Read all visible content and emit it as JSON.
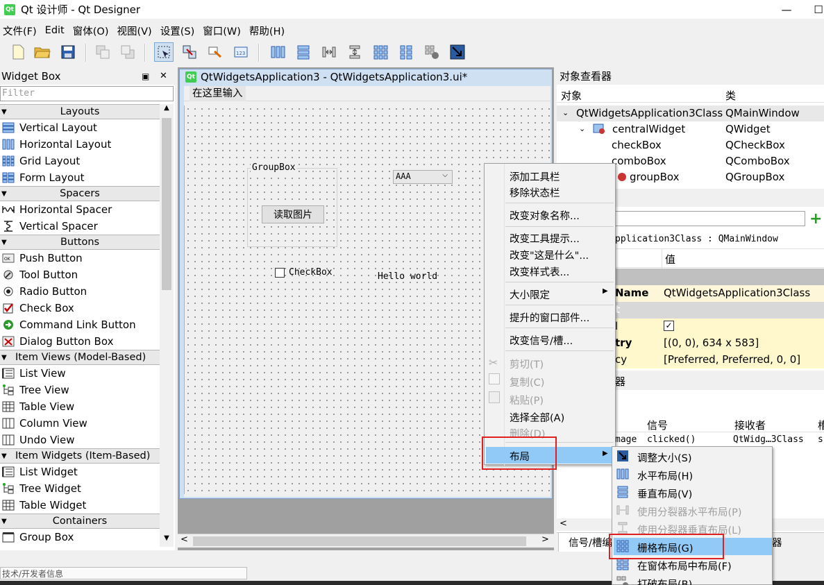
{
  "window": {
    "title": "Qt 设计师 - Qt Designer",
    "logo": "Qt",
    "min": "—",
    "max": "☐"
  },
  "menubar": [
    "文件(F)",
    "Edit",
    "窗体(O)",
    "视图(V)",
    "设置(S)",
    "窗口(W)",
    "帮助(H)"
  ],
  "toolbar": {
    "icons": [
      "new-file-icon",
      "open-folder-icon",
      "save-icon",
      "send-back-icon",
      "bring-front-icon",
      "edit-widgets-icon",
      "edit-signals-icon",
      "edit-buddies-icon",
      "edit-tab-order-icon",
      "layout-horizontal-icon",
      "layout-vertical-icon",
      "layout-h-splitter-icon",
      "layout-v-splitter-icon",
      "layout-grid-icon",
      "layout-form-icon",
      "break-layout-icon",
      "adjust-size-icon"
    ]
  },
  "widgetbox": {
    "title": "Widget Box",
    "filter_placeholder": "Filter",
    "float": "▣",
    "close": "✕",
    "categories": [
      {
        "label": "Layouts",
        "items": [
          "Vertical Layout",
          "Horizontal Layout",
          "Grid Layout",
          "Form Layout"
        ]
      },
      {
        "label": "Spacers",
        "items": [
          "Horizontal Spacer",
          "Vertical Spacer"
        ]
      },
      {
        "label": "Buttons",
        "items": [
          "Push Button",
          "Tool Button",
          "Radio Button",
          "Check Box",
          "Command Link Button",
          "Dialog Button Box"
        ]
      },
      {
        "label": "Item Views (Model-Based)",
        "items": [
          "List View",
          "Tree View",
          "Table View",
          "Column View",
          "Undo View"
        ]
      },
      {
        "label": "Item Widgets (Item-Based)",
        "items": [
          "List Widget",
          "Tree Widget",
          "Table Widget"
        ]
      },
      {
        "label": "Containers",
        "items": [
          "Group Box"
        ]
      }
    ]
  },
  "form": {
    "title": "QtWidgetsApplication3 - QtWidgetsApplication3.ui*",
    "logo": "Qt",
    "menu_placeholder": "在这里输入",
    "groupbox_title": "GroupBox",
    "button_label": "读取图片",
    "combo_value": "AAA",
    "checkbox_label": "CheckBox",
    "label_text": "Hello world"
  },
  "object_inspector": {
    "title": "对象查看器",
    "col_object": "对象",
    "col_class": "类",
    "rows": [
      {
        "name": "QtWidgetsApplication3Class",
        "cls": "QMainWindow"
      },
      {
        "name": "centralWidget",
        "cls": "QWidget"
      },
      {
        "name": "checkBox",
        "cls": "QCheckBox"
      },
      {
        "name": "comboBox",
        "cls": "QComboBox"
      },
      {
        "name": "groupBox",
        "cls": "QGroupBox"
      }
    ]
  },
  "property_editor": {
    "object_line": "pplication3Class : QMainWindow",
    "col_value": "值",
    "rows": [
      {
        "name": "Name",
        "value": "QtWidgetsApplication3Class"
      },
      {
        "name": "t",
        "value": ""
      },
      {
        "name": "l",
        "value": "✓"
      },
      {
        "name": "try",
        "value": "[(0, 0), 634 x 583]"
      },
      {
        "name": "cy",
        "value": "[Preferred, Preferred, 0, 0]"
      }
    ]
  },
  "signal_editor": {
    "title": "器",
    "col_signal": "信号",
    "col_receiver": "接收者",
    "col_more": "槽",
    "row": {
      "sender": "mage",
      "signal": "clicked()",
      "receiver": "QtWidg…3Class",
      "slot": "s"
    },
    "tab_label": "信号/槽编",
    "tab_label2": "器"
  },
  "context_menu": {
    "items": [
      {
        "label": "添加工具栏",
        "disabled": false
      },
      {
        "label": "移除状态栏",
        "disabled": false
      },
      {
        "label": "改变对象名称...",
        "disabled": false
      },
      {
        "label": "改变工具提示...",
        "disabled": false
      },
      {
        "label": "改变\"这是什么\"...",
        "disabled": false
      },
      {
        "label": "改变样式表...",
        "disabled": false
      },
      {
        "label": "大小限定",
        "disabled": false
      },
      {
        "label": "提升的窗口部件...",
        "disabled": false
      },
      {
        "label": "改变信号/槽...",
        "disabled": false
      },
      {
        "label": "剪切(T)",
        "disabled": true
      },
      {
        "label": "复制(C)",
        "disabled": true
      },
      {
        "label": "粘贴(P)",
        "disabled": true
      },
      {
        "label": "选择全部(A)",
        "disabled": false
      },
      {
        "label": "删除(D)",
        "disabled": true
      },
      {
        "label": "布局",
        "disabled": false
      }
    ]
  },
  "layout_submenu": {
    "items": [
      {
        "label": "调整大小(S)",
        "disabled": false
      },
      {
        "label": "水平布局(H)",
        "disabled": false
      },
      {
        "label": "垂直布局(V)",
        "disabled": false
      },
      {
        "label": "使用分裂器水平布局(P)",
        "disabled": true
      },
      {
        "label": "使用分裂器垂直布局(L)",
        "disabled": true
      },
      {
        "label": "栅格布局(G)",
        "disabled": false
      },
      {
        "label": "在窗体布局中布局(F)",
        "disabled": false
      },
      {
        "label": "打破布局(B)",
        "disabled": false
      }
    ]
  },
  "status": {
    "left_text": "技术/开发者信息"
  },
  "colors": {
    "highlight": "#91c9f7",
    "annotation": "#e02020",
    "form_frame": "#cfe0f3",
    "qt_green": "#41cd52"
  }
}
